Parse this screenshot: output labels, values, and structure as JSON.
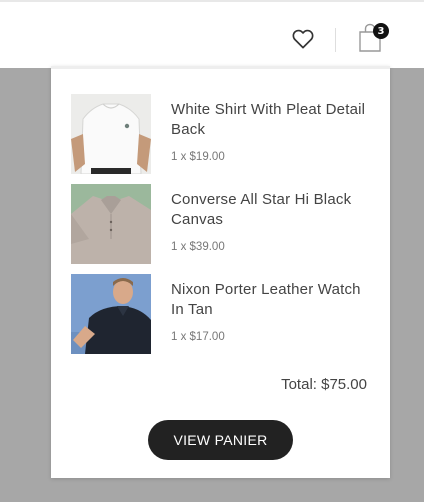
{
  "header": {
    "cart_count": "3",
    "icons": [
      "heart-icon",
      "shopping-bag-icon"
    ]
  },
  "cart": {
    "items": [
      {
        "name": "White Shirt With Pleat Detail Back",
        "qty_price": "1 x $19.00",
        "thumb": "white-shirt-thumbnail"
      },
      {
        "name": "Converse All Star Hi Black Canvas",
        "qty_price": "1 x $39.00",
        "thumb": "polo-on-green-thumbnail"
      },
      {
        "name": "Nixon Porter Leather Watch In Tan",
        "qty_price": "1 x $17.00",
        "thumb": "man-in-polo-thumbnail"
      }
    ],
    "total": "Total: $75.00",
    "button_label": "VIEW PANIER"
  },
  "colors": {
    "overlay": "#a7a7a7",
    "button": "#222222",
    "badge": "#111111"
  }
}
